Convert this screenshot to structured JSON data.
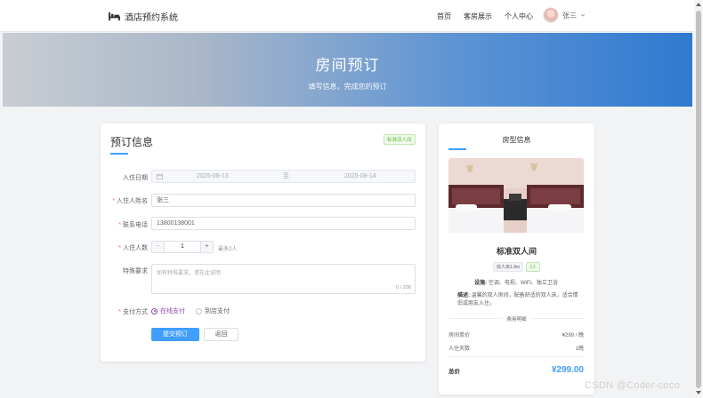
{
  "app": {
    "title": "酒店预约系统"
  },
  "nav": {
    "items": [
      "首页",
      "客房展示",
      "个人中心"
    ]
  },
  "user": {
    "name": "张三"
  },
  "hero": {
    "title": "房间预订",
    "subtitle": "填写信息，完成您的预订"
  },
  "form": {
    "title": "预订信息",
    "room_tag": "标准双人间",
    "checkin": {
      "label": "入住日期",
      "start": "2025-08-13",
      "separator": "至",
      "end": "2025-08-14"
    },
    "name": {
      "label": "入住人姓名",
      "value": "张三"
    },
    "phone": {
      "label": "联系电话",
      "value": "13800138001"
    },
    "guests": {
      "label": "入住人数",
      "value": "1",
      "minus": "−",
      "plus": "+",
      "hint": "最多2人"
    },
    "special": {
      "label": "特殊要求",
      "placeholder": "如有特殊要求，请在此说明",
      "counter": "0 / 200"
    },
    "payment": {
      "label": "支付方式",
      "options": [
        "在线支付",
        "到店支付"
      ],
      "selected": "在线支付"
    },
    "submit": "提交预订",
    "back": "返回"
  },
  "room": {
    "card_title": "房型信息",
    "name": "标准双人间",
    "tags": [
      "双人床1.8m",
      "2人"
    ],
    "facilities_label": "设施:",
    "facilities": "空调、电视、WiFi、独立卫浴",
    "desc_label": "描述:",
    "desc": "温馨的双人房间，配备舒适的双人床，适合情侣或朋友入住。",
    "fee_title": "费用明细",
    "unit_price_label": "房间单价",
    "unit_price": "¥299 / 晚",
    "nights_label": "入住天数",
    "nights": "1晚",
    "total_label": "总价",
    "total": "¥299.00"
  },
  "watermark": "CSDN @Coder-coco",
  "colors": {
    "primary": "#409eff",
    "success": "#67c23a",
    "danger": "#f56c6c",
    "radio": "#8e44ad"
  }
}
